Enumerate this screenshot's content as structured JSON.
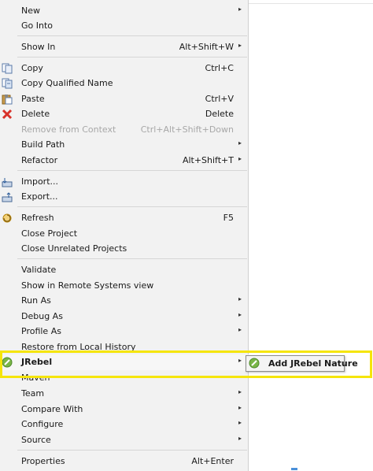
{
  "menu": {
    "items": [
      {
        "label": "New",
        "submenu": true
      },
      {
        "label": "Go Into"
      },
      {
        "label": "Show In",
        "shortcut": "Alt+Shift+W",
        "submenu": true
      },
      {
        "label": "Copy",
        "shortcut": "Ctrl+C",
        "icon": "copy-icon"
      },
      {
        "label": "Copy Qualified Name",
        "icon": "copy-qualified-name-icon"
      },
      {
        "label": "Paste",
        "shortcut": "Ctrl+V",
        "icon": "paste-icon"
      },
      {
        "label": "Delete",
        "shortcut": "Delete",
        "icon": "delete-icon"
      },
      {
        "label": "Remove from Context",
        "shortcut": "Ctrl+Alt+Shift+Down",
        "disabled": true
      },
      {
        "label": "Build Path",
        "submenu": true
      },
      {
        "label": "Refactor",
        "shortcut": "Alt+Shift+T",
        "submenu": true
      },
      {
        "label": "Import...",
        "icon": "import-icon"
      },
      {
        "label": "Export...",
        "icon": "export-icon"
      },
      {
        "label": "Refresh",
        "shortcut": "F5",
        "icon": "refresh-icon"
      },
      {
        "label": "Close Project"
      },
      {
        "label": "Close Unrelated Projects"
      },
      {
        "label": "Validate"
      },
      {
        "label": "Show in Remote Systems view"
      },
      {
        "label": "Run As",
        "submenu": true
      },
      {
        "label": "Debug As",
        "submenu": true
      },
      {
        "label": "Profile As",
        "submenu": true
      },
      {
        "label": "Restore from Local History"
      },
      {
        "label": "JRebel",
        "submenu": true,
        "icon": "jrebel-icon"
      },
      {
        "label": "Maven"
      },
      {
        "label": "Team",
        "submenu": true
      },
      {
        "label": "Compare With",
        "submenu": true
      },
      {
        "label": "Configure",
        "submenu": true
      },
      {
        "label": "Source",
        "submenu": true
      },
      {
        "label": "Properties",
        "shortcut": "Alt+Enter"
      }
    ],
    "arrow_glyph": "▸"
  },
  "submenu": {
    "item_label": "Add JRebel Nature",
    "icon": "jrebel-icon"
  },
  "colors": {
    "highlight_border": "#f5e50a",
    "jrebel_green": "#7ab648",
    "delete_red": "#d8322a"
  }
}
